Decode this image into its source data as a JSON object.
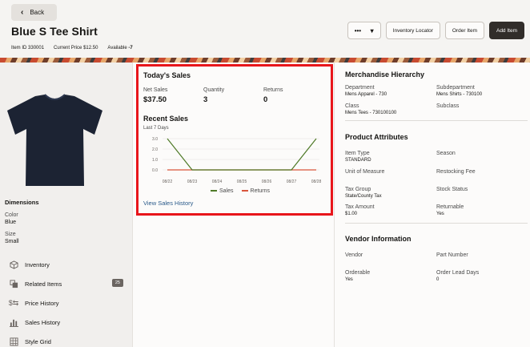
{
  "header": {
    "back_label": "Back",
    "title": "Blue S Tee Shirt",
    "item_id_label": "Item ID",
    "item_id": "330001",
    "current_price_label": "Current Price",
    "current_price": "$12.50",
    "available_label": "Available",
    "available": "-7",
    "actions": {
      "dots_label": "•••",
      "inventory_locator": "Inventory Locator",
      "order_item": "Order Item",
      "add_item": "Add Item"
    }
  },
  "left": {
    "dimensions_title": "Dimensions",
    "color_label": "Color",
    "color_value": "Blue",
    "size_label": "Size",
    "size_value": "Small",
    "nav": [
      {
        "label": "Inventory"
      },
      {
        "label": "Related Items",
        "badge": "25"
      },
      {
        "label": "Price History"
      },
      {
        "label": "Sales History"
      },
      {
        "label": "Style Grid"
      }
    ]
  },
  "sales": {
    "title": "Today's Sales",
    "net_sales_label": "Net Sales",
    "net_sales": "$37.50",
    "quantity_label": "Quantity",
    "quantity": "3",
    "returns_label": "Returns",
    "returns": "0",
    "recent_title": "Recent Sales",
    "recent_sub": "Last 7 Days",
    "link": "View Sales History"
  },
  "chart_data": {
    "type": "line",
    "x": [
      "08/22",
      "08/23",
      "08/24",
      "08/25",
      "08/26",
      "08/27",
      "08/28"
    ],
    "yticks": [
      "0.0",
      "1.0",
      "2.0",
      "3.0"
    ],
    "ylim": [
      0,
      3
    ],
    "series": [
      {
        "name": "Sales",
        "values": [
          3,
          0,
          0,
          0,
          0,
          0,
          3
        ],
        "color": "#4f7a28"
      },
      {
        "name": "Returns",
        "values": [
          0,
          0,
          0,
          0,
          0,
          0,
          0
        ],
        "color": "#d9553b"
      }
    ],
    "grid": true
  },
  "merch": {
    "title": "Merchandise Hierarchy",
    "department_label": "Department",
    "department": "Mens Apparel - 730",
    "subdepartment_label": "Subdepartment",
    "subdepartment": "Mens Shirts - 730100",
    "class_label": "Class",
    "class": "Mens Tees - 730100100",
    "subclass_label": "Subclass"
  },
  "attrs": {
    "title": "Product Attributes",
    "item_type_label": "Item Type",
    "item_type": "STANDARD",
    "season_label": "Season",
    "uom_label": "Unit of Measure",
    "restocking_label": "Restocking Fee",
    "tax_group_label": "Tax Group",
    "tax_group": "State/County Tax",
    "stock_status_label": "Stock Status",
    "tax_amount_label": "Tax Amount",
    "tax_amount": "$1.00",
    "returnable_label": "Returnable",
    "returnable": "Yes"
  },
  "vendor": {
    "title": "Vendor Information",
    "vendor_label": "Vendor",
    "part_number_label": "Part Number",
    "orderable_label": "Orderable",
    "orderable": "Yes",
    "lead_days_label": "Order Lead Days",
    "lead_days": "0"
  }
}
